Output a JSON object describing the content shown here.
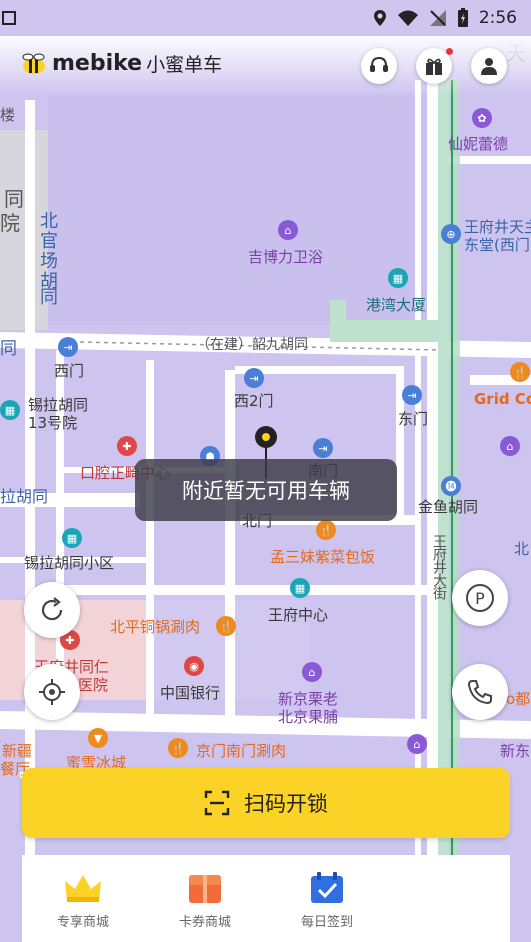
{
  "status_bar": {
    "time": "2:56"
  },
  "header": {
    "brand": "mebike",
    "brand_cn": "小蜜单车",
    "icons": [
      "customer-service-icon",
      "gift-icon",
      "user-icon"
    ],
    "gift_has_badge": true
  },
  "map": {
    "labels": {
      "xianni": "仙妮蕾德",
      "wangfujing_church_1": "王府井天主",
      "wangfujing_church_2": "东堂(西门",
      "beiguan_1": "北",
      "beiguan_2": "官",
      "beiguan_3": "场",
      "beiguan_4": "胡",
      "beiguan_5": "同",
      "tong": "同",
      "yuan": "院",
      "lou": "楼",
      "jiboli": "吉博力卫浴",
      "gangwan": "港湾大厦",
      "shaojiu": "（在建）韶九胡同",
      "tong_left": "同",
      "ximen": "西门",
      "xi2men": "西2门",
      "dongmen": "东门",
      "grid": "Grid Co",
      "xila_1": "锡拉胡同",
      "xila_2": "13号院",
      "kouqiang": "口腔正畸中心",
      "la_hutong": "拉胡同",
      "nanmen": "南门",
      "beimen": "北门",
      "jinyu": "金鱼胡同",
      "xila_xiaoqu": "锡拉胡同小区",
      "mengsanmei": "孟三妹紫菜包饭",
      "wangfu_center": "王府中心",
      "wangfujing_street": "王府井大街",
      "beiping": "北平铜锅涮肉",
      "bank": "中国银行",
      "wangfujing_hosp_1": "王府井同仁",
      "wangfujing_hosp_2": "医院",
      "xinjing_1": "新京栗老",
      "xinjing_2": "北京果脯",
      "xinjiang_1": "新疆",
      "xinjiang_2": "餐厅",
      "mixue": "蜜雪冰城",
      "jingmen": "京门南门涮肉",
      "right_bei": "北",
      "right_xin": "新东",
      "right_du": "o都",
      "east_tian": "天"
    }
  },
  "toast": "附近暂无可用车辆",
  "scan_button": {
    "label": "扫码开锁"
  },
  "bottom_nav": [
    {
      "label": "专享商城",
      "icon": "crown-icon"
    },
    {
      "label": "卡券商城",
      "icon": "coupon-icon"
    },
    {
      "label": "每日签到",
      "icon": "checkin-calendar-icon"
    }
  ]
}
